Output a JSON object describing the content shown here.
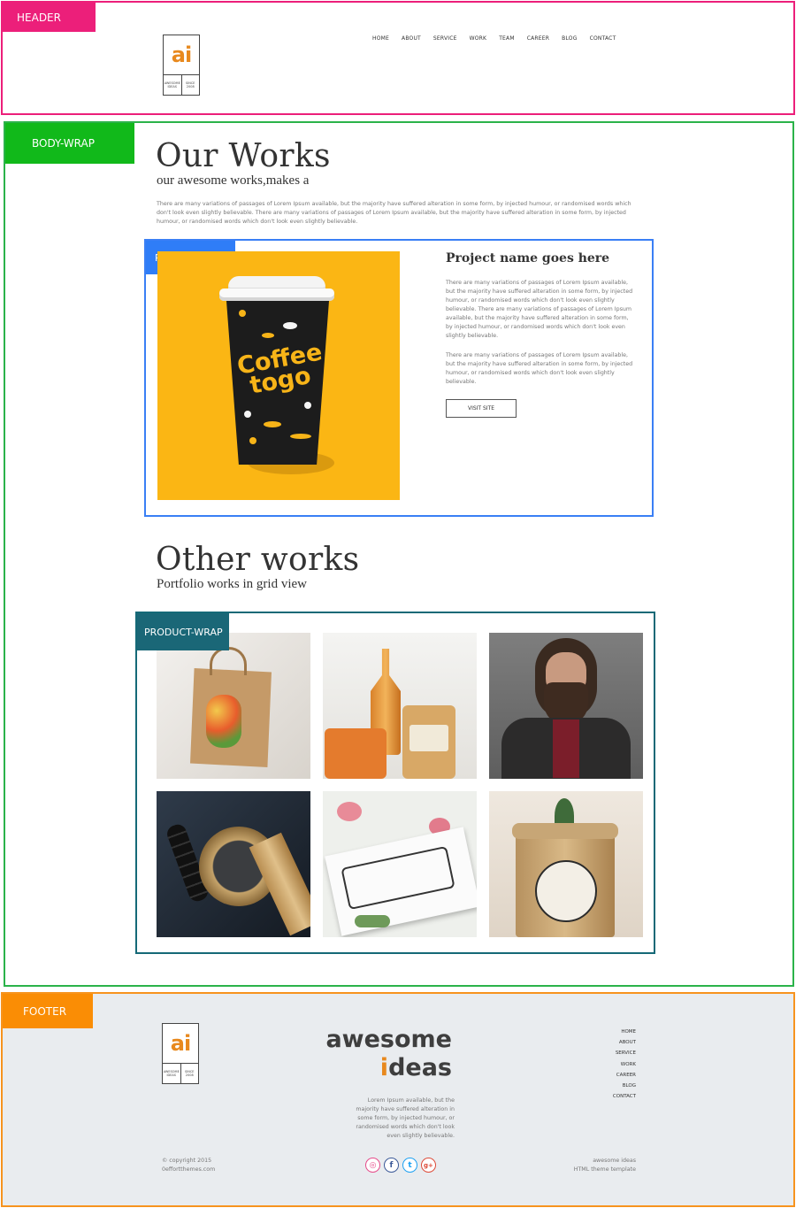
{
  "labels": {
    "header": "HEADER",
    "body_wrap": "BODY-WRAP",
    "product": "PRODUCT",
    "product_wrap": "PRODUCT-WRAP",
    "footer": "FOOTER"
  },
  "logo": {
    "mark": "ai",
    "left_text": "AWESOME IDEAS",
    "right_text": "SINCE 2008"
  },
  "nav": [
    "HOME",
    "ABOUT",
    "SERVICE",
    "WORK",
    "TEAM",
    "CAREER",
    "BLOG",
    "CONTACT"
  ],
  "our_works": {
    "title": "Our Works",
    "subtitle": "our awesome works,makes a",
    "intro": "There are many variations of passages of Lorem Ipsum available, but the majority have suffered alteration in some form, by injected humour, or randomised words which don't look even slightly believable. There are many variations of passages of Lorem Ipsum available, but the majority have suffered alteration in some form, by injected humour, or randomised words which don't look even slightly believable."
  },
  "product": {
    "image_text": "Coffee togo",
    "title": "Project name goes here",
    "para1": "There are many variations of passages of Lorem Ipsum available, but the majority have suffered alteration in some form, by injected humour, or randomised words which don't look even slightly believable. There are many variations of passages of Lorem Ipsum available, but the majority have suffered alteration in some form, by injected humour, or randomised words which don't look even slightly believable.",
    "para2": "There are many variations of passages of Lorem Ipsum available, but the majority have suffered alteration in some form, by injected humour, or randomised words which don't look even slightly believable.",
    "button": "VISIT SITE"
  },
  "other_works": {
    "title": "Other works",
    "subtitle": "Portfolio works in grid view"
  },
  "footer": {
    "brand_line1": "awesome",
    "brand_line2_accent": "i",
    "brand_line2_rest": "deas",
    "description": "Lorem Ipsum available, but the majority have suffered alteration in some form, by injected humour, or randomised words which don't look even slightly believable.",
    "copyright": "© copyright 2015",
    "site": "0effortthemes.com",
    "credit_line1": "awesome ideas",
    "credit_line2": "HTML theme template",
    "nav": [
      "HOME",
      "ABOUT",
      "SERVICE",
      "WORK",
      "CAREER",
      "BLOG",
      "CONTACT"
    ]
  },
  "social": [
    {
      "name": "dribbble-icon",
      "glyph": "◎",
      "color": "#e64b8a"
    },
    {
      "name": "facebook-icon",
      "glyph": "f",
      "color": "#3b5998"
    },
    {
      "name": "twitter-icon",
      "glyph": "t",
      "color": "#1da1f2"
    },
    {
      "name": "google-plus-icon",
      "glyph": "g+",
      "color": "#dd4b39"
    }
  ],
  "colors": {
    "header_tag": "#ec1f7a",
    "body_tag": "#11b91a",
    "product_tag": "#2f7df7",
    "product_wrap_tag": "#1a6777",
    "footer_tag": "#fa8d05",
    "accent": "#e8891e"
  }
}
